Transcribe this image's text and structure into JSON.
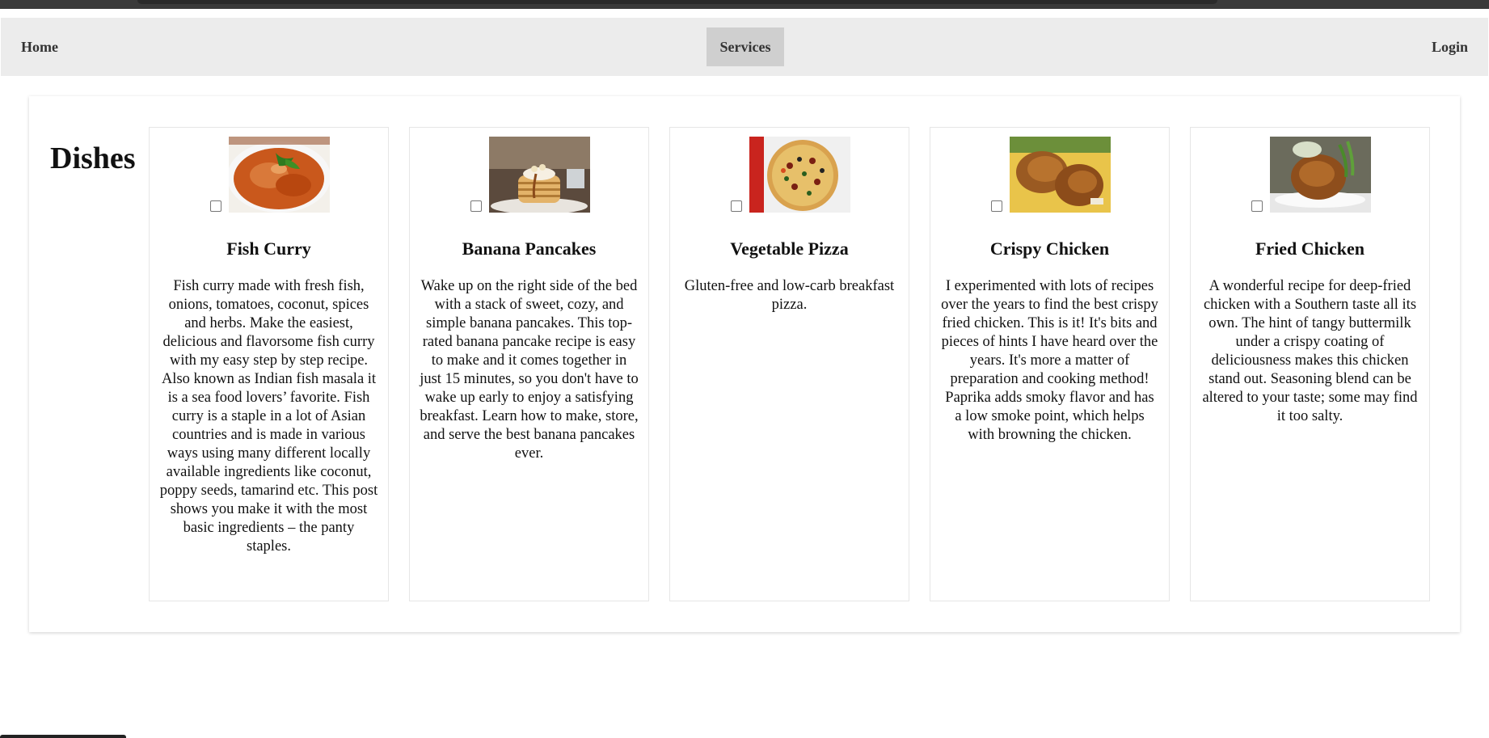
{
  "nav": {
    "home": "Home",
    "services": "Services",
    "login": "Login"
  },
  "main": {
    "title": "Dishes",
    "dishes": [
      {
        "name": "Fish Curry",
        "image_icon": "fish-curry-photo",
        "checked": false,
        "description": "Fish curry made with fresh fish, onions, tomatoes, coconut, spices and herbs. Make the easiest, delicious and flavorsome fish curry with my easy step by step recipe. Also known as Indian fish masala it is a sea food lovers’ favorite. Fish curry is a staple in a lot of Asian countries and is made in various ways using many different locally available ingredients like coconut, poppy seeds, tamarind etc. This post shows you make it with the most basic ingredients – the panty staples."
      },
      {
        "name": "Banana Pancakes",
        "image_icon": "pancakes-photo",
        "checked": false,
        "description": "Wake up on the right side of the bed with a stack of sweet, cozy, and simple banana pancakes. This top-rated banana pancake recipe is easy to make and it comes together in just 15 minutes, so you don't have to wake up early to enjoy a satisfying breakfast. Learn how to make, store, and serve the best banana pancakes ever."
      },
      {
        "name": "Vegetable Pizza",
        "image_icon": "pizza-photo",
        "checked": false,
        "description": "Gluten-free and low-carb breakfast pizza."
      },
      {
        "name": "Crispy Chicken",
        "image_icon": "crispy-chicken-photo",
        "checked": false,
        "description": "I experimented with lots of recipes over the years to find the best crispy fried chicken. This is it! It's bits and pieces of hints I have heard over the years. It's more a matter of preparation and cooking method! Paprika adds smoky flavor and has a low smoke point, which helps with browning the chicken."
      },
      {
        "name": "Fried Chicken",
        "image_icon": "fried-chicken-photo",
        "checked": false,
        "description": "A wonderful recipe for deep-fried chicken with a Southern taste all its own. The hint of tangy buttermilk under a crispy coating of deliciousness makes this chicken stand out. Seasoning blend can be altered to your taste; some may find it too salty."
      }
    ]
  },
  "colors": {
    "navbar_bg": "#ececec",
    "active_nav_bg": "#cfcfcf",
    "card_border": "#e6e6e6"
  }
}
